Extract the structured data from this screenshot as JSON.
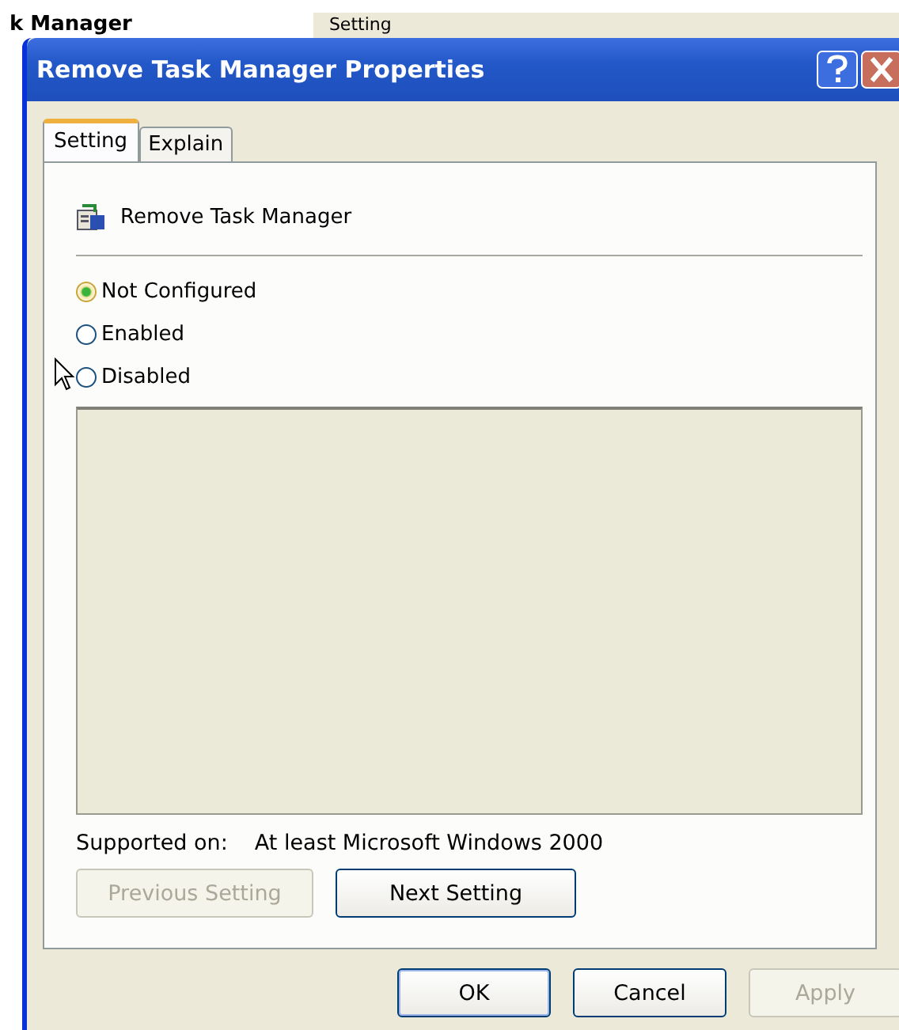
{
  "background_window": {
    "title": "k Manager",
    "column_1": "Setting"
  },
  "window": {
    "title": "Remove Task Manager Properties"
  },
  "tabs": [
    {
      "label": "Setting",
      "selected": true
    },
    {
      "label": "Explain",
      "selected": false
    }
  ],
  "policy": {
    "name": "Remove Task Manager"
  },
  "options": [
    {
      "label": "Not Configured",
      "selected": true
    },
    {
      "label": "Enabled",
      "selected": false
    },
    {
      "label": "Disabled",
      "selected": false
    }
  ],
  "supported_on": {
    "label": "Supported on:",
    "value": "At least Microsoft Windows 2000"
  },
  "nav_buttons": [
    {
      "label": "Previous Setting",
      "disabled": true
    },
    {
      "label": "Next Setting",
      "disabled": false
    }
  ],
  "buttons": [
    {
      "label": "OK",
      "disabled": false,
      "default": true
    },
    {
      "label": "Cancel",
      "disabled": false,
      "default": false
    },
    {
      "label": "Apply",
      "disabled": true,
      "default": false
    }
  ]
}
